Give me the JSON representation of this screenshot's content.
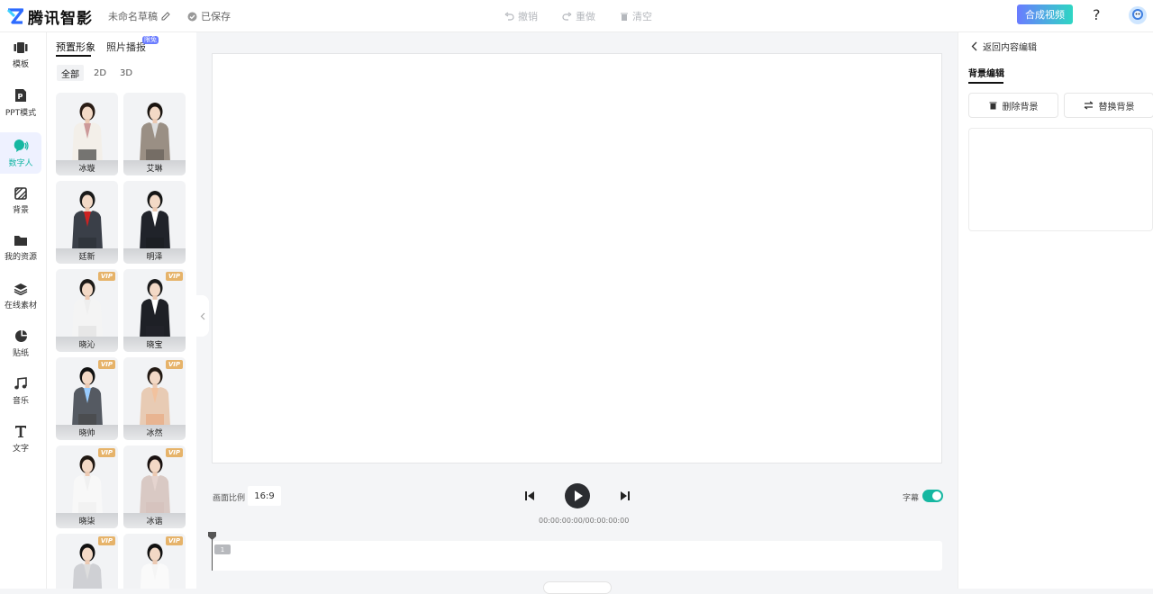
{
  "topbar": {
    "logo_text": "腾讯智影",
    "draft_name": "未命名草稿",
    "saved_status": "已保存",
    "undo_label": "撤销",
    "redo_label": "重做",
    "clear_label": "清空",
    "synth_label": "合成视频",
    "help_label": "?"
  },
  "sidenav": {
    "items": [
      {
        "label": "模板",
        "icon": "template-icon"
      },
      {
        "label": "PPT模式",
        "icon": "ppt-icon"
      },
      {
        "label": "数字人",
        "icon": "digital-human-icon"
      },
      {
        "label": "背景",
        "icon": "background-icon"
      },
      {
        "label": "我的资源",
        "icon": "folder-icon"
      },
      {
        "label": "在线素材",
        "icon": "layers-icon"
      },
      {
        "label": "贴纸",
        "icon": "sticker-icon"
      },
      {
        "label": "音乐",
        "icon": "music-icon"
      },
      {
        "label": "文字",
        "icon": "text-icon"
      }
    ],
    "active_index": 2
  },
  "panel": {
    "tabs": [
      "预置形象",
      "照片播报"
    ],
    "new_badge": "限免",
    "subtabs": [
      "全部",
      "2D",
      "3D"
    ],
    "cards": [
      {
        "name": "冰璇",
        "vip": "",
        "vip_on": false
      },
      {
        "name": "艾琳",
        "vip": "",
        "vip_on": false
      },
      {
        "name": "廷新",
        "vip": "",
        "vip_on": false
      },
      {
        "name": "明泽",
        "vip": "",
        "vip_on": false
      },
      {
        "name": "晓沁",
        "vip": "VIP",
        "vip_on": true
      },
      {
        "name": "晓宝",
        "vip": "VIP",
        "vip_on": true
      },
      {
        "name": "晓帅",
        "vip": "VIP",
        "vip_on": true
      },
      {
        "name": "冰然",
        "vip": "VIP",
        "vip_on": true
      },
      {
        "name": "晓柒",
        "vip": "VIP",
        "vip_on": true
      },
      {
        "name": "冰谐",
        "vip": "VIP",
        "vip_on": true
      },
      {
        "name": "",
        "vip": "VIP",
        "vip_on": true
      },
      {
        "name": "",
        "vip": "VIP",
        "vip_on": true
      }
    ]
  },
  "editor": {
    "ratio_label": "画面比例",
    "ratio_value": "16:9",
    "time": "00:00:00:00/00:00:00:00",
    "subtitle_label": "字幕",
    "subtitle_on": true,
    "clip_number": "1"
  },
  "right": {
    "back_label": "返回内容编辑",
    "tab_label": "背景编辑",
    "delete_bg": "删除背景",
    "replace_bg": "替换背景"
  },
  "colors": {
    "accent": "#15b7a1",
    "primary_gradient_start": "#6a7cff",
    "vip": "#e6b36a"
  }
}
